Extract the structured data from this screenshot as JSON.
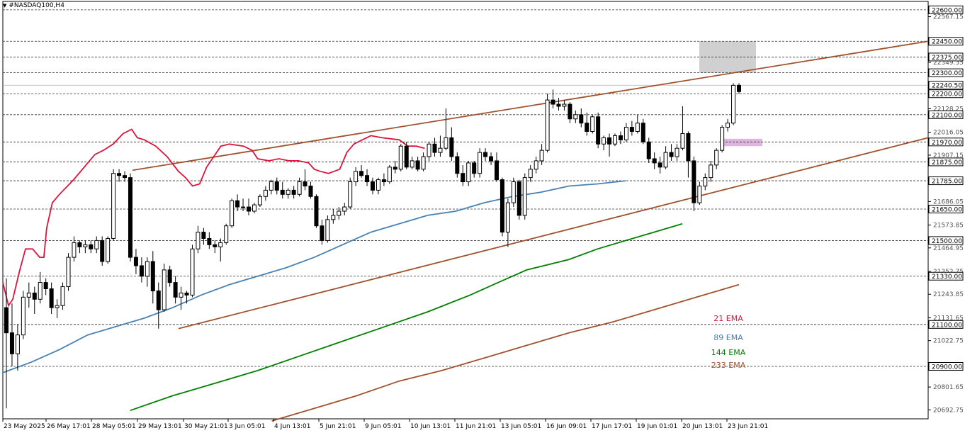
{
  "window": {
    "symbol_label": "#NASDAQ100,H4"
  },
  "chart_data": {
    "type": "candlestick",
    "instrument": "#NASDAQ100",
    "timeframe": "H4",
    "ylim": [
      20650,
      22640
    ],
    "y_ticks": [
      22567.15,
      22349.35,
      22128.25,
      22016.05,
      21907.15,
      21686.05,
      21573.85,
      21464.95,
      21352.75,
      21243.85,
      21131.65,
      21022.75,
      20801.65,
      20692.75
    ],
    "x_ticks": [
      "23 May 2025",
      "26 May 17:01",
      "28 May 05:01",
      "29 May 13:01",
      "30 May 21:01",
      "3 Jun 05:01",
      "4 Jun 13:01",
      "5 Jun 21:01",
      "9 Jun 05:01",
      "10 Jun 13:01",
      "11 Jun 21:01",
      "13 Jun 05:01",
      "16 Jun 09:01",
      "17 Jun 17:01",
      "19 Jun 01:01",
      "20 Jun 13:01",
      "23 Jun 21:01"
    ],
    "level_lines": [
      22600.0,
      22450.0,
      22375.0,
      22300.0,
      22200.0,
      22100.0,
      21970.0,
      21875.0,
      21785.0,
      21650.0,
      21500.0,
      21330.0,
      21100.0,
      20900.0
    ],
    "current_price": 22240.5,
    "candles": [
      [
        21180,
        21320,
        20700,
        21060
      ],
      [
        21060,
        21200,
        20900,
        20960
      ],
      [
        20960,
        21100,
        20880,
        21050
      ],
      [
        21050,
        21260,
        21030,
        21230
      ],
      [
        21230,
        21300,
        21180,
        21250
      ],
      [
        21250,
        21280,
        21150,
        21220
      ],
      [
        21220,
        21350,
        21200,
        21300
      ],
      [
        21300,
        21320,
        21240,
        21270
      ],
      [
        21270,
        21300,
        21150,
        21180
      ],
      [
        21180,
        21220,
        21130,
        21190
      ],
      [
        21190,
        21300,
        21170,
        21280
      ],
      [
        21280,
        21440,
        21260,
        21420
      ],
      [
        21420,
        21520,
        21400,
        21490
      ],
      [
        21490,
        21500,
        21440,
        21470
      ],
      [
        21470,
        21500,
        21440,
        21480
      ],
      [
        21480,
        21500,
        21440,
        21460
      ],
      [
        21460,
        21520,
        21440,
        21500
      ],
      [
        21500,
        21520,
        21380,
        21400
      ],
      [
        21400,
        21520,
        21390,
        21510
      ],
      [
        21510,
        21840,
        21500,
        21820
      ],
      [
        21820,
        21840,
        21780,
        21810
      ],
      [
        21810,
        21830,
        21780,
        21800
      ],
      [
        21800,
        21820,
        21400,
        21420
      ],
      [
        21420,
        21460,
        21340,
        21380
      ],
      [
        21380,
        21420,
        21300,
        21330
      ],
      [
        21330,
        21420,
        21280,
        21400
      ],
      [
        21400,
        21450,
        21200,
        21260
      ],
      [
        21260,
        21300,
        21080,
        21170
      ],
      [
        21170,
        21390,
        21160,
        21360
      ],
      [
        21360,
        21380,
        21280,
        21300
      ],
      [
        21300,
        21330,
        21200,
        21230
      ],
      [
        21230,
        21280,
        21170,
        21250
      ],
      [
        21250,
        21260,
        21200,
        21240
      ],
      [
        21240,
        21480,
        21230,
        21460
      ],
      [
        21460,
        21570,
        21440,
        21540
      ],
      [
        21540,
        21560,
        21480,
        21510
      ],
      [
        21510,
        21540,
        21460,
        21480
      ],
      [
        21480,
        21500,
        21440,
        21470
      ],
      [
        21470,
        21510,
        21400,
        21490
      ],
      [
        21490,
        21580,
        21480,
        21570
      ],
      [
        21570,
        21700,
        21560,
        21690
      ],
      [
        21690,
        21720,
        21640,
        21660
      ],
      [
        21660,
        21700,
        21640,
        21660
      ],
      [
        21660,
        21700,
        21620,
        21640
      ],
      [
        21640,
        21680,
        21630,
        21670
      ],
      [
        21670,
        21720,
        21660,
        21710
      ],
      [
        21710,
        21760,
        21690,
        21740
      ],
      [
        21740,
        21790,
        21720,
        21780
      ],
      [
        21780,
        21800,
        21720,
        21740
      ],
      [
        21740,
        21780,
        21700,
        21720
      ],
      [
        21720,
        21750,
        21700,
        21740
      ],
      [
        21740,
        21760,
        21700,
        21720
      ],
      [
        21720,
        21800,
        21710,
        21780
      ],
      [
        21780,
        21840,
        21740,
        21760
      ],
      [
        21760,
        21780,
        21700,
        21710
      ],
      [
        21710,
        21720,
        21560,
        21570
      ],
      [
        21570,
        21600,
        21480,
        21500
      ],
      [
        21500,
        21620,
        21490,
        21600
      ],
      [
        21600,
        21650,
        21580,
        21620
      ],
      [
        21620,
        21660,
        21600,
        21640
      ],
      [
        21640,
        21680,
        21620,
        21660
      ],
      [
        21660,
        21800,
        21650,
        21780
      ],
      [
        21780,
        21850,
        21760,
        21830
      ],
      [
        21830,
        21860,
        21800,
        21810
      ],
      [
        21810,
        21840,
        21760,
        21780
      ],
      [
        21780,
        21800,
        21720,
        21740
      ],
      [
        21740,
        21800,
        21720,
        21790
      ],
      [
        21790,
        21820,
        21760,
        21780
      ],
      [
        21780,
        21860,
        21770,
        21850
      ],
      [
        21850,
        21880,
        21820,
        21840
      ],
      [
        21840,
        21960,
        21830,
        21950
      ],
      [
        21950,
        21970,
        21840,
        21850
      ],
      [
        21850,
        21900,
        21840,
        21880
      ],
      [
        21880,
        21900,
        21830,
        21840
      ],
      [
        21840,
        21920,
        21830,
        21900
      ],
      [
        21900,
        21970,
        21880,
        21960
      ],
      [
        21960,
        21990,
        21900,
        21920
      ],
      [
        21920,
        22000,
        21900,
        21940
      ],
      [
        21940,
        22130,
        21930,
        21990
      ],
      [
        21990,
        22040,
        21880,
        21900
      ],
      [
        21900,
        21920,
        21800,
        21820
      ],
      [
        21820,
        21860,
        21760,
        21780
      ],
      [
        21780,
        21880,
        21760,
        21870
      ],
      [
        21870,
        21880,
        21800,
        21820
      ],
      [
        21820,
        21940,
        21800,
        21920
      ],
      [
        21920,
        21940,
        21880,
        21900
      ],
      [
        21900,
        21920,
        21860,
        21880
      ],
      [
        21880,
        21920,
        21780,
        21790
      ],
      [
        21790,
        21800,
        21520,
        21540
      ],
      [
        21540,
        21700,
        21470,
        21680
      ],
      [
        21680,
        21800,
        21660,
        21780
      ],
      [
        21780,
        21790,
        21600,
        21620
      ],
      [
        21620,
        21820,
        21600,
        21800
      ],
      [
        21800,
        21860,
        21780,
        21840
      ],
      [
        21840,
        21900,
        21820,
        21880
      ],
      [
        21880,
        21960,
        21860,
        21930
      ],
      [
        21930,
        22200,
        21920,
        22170
      ],
      [
        22170,
        22220,
        22130,
        22150
      ],
      [
        22150,
        22180,
        22120,
        22140
      ],
      [
        22140,
        22170,
        22120,
        22150
      ],
      [
        22150,
        22160,
        22060,
        22080
      ],
      [
        22080,
        22120,
        22060,
        22100
      ],
      [
        22100,
        22130,
        22040,
        22060
      ],
      [
        22060,
        22110,
        22000,
        22020
      ],
      [
        22020,
        22100,
        22010,
        22090
      ],
      [
        22090,
        22110,
        21940,
        21960
      ],
      [
        21960,
        22000,
        21930,
        21990
      ],
      [
        21990,
        22010,
        21900,
        21960
      ],
      [
        21960,
        22010,
        21950,
        22000
      ],
      [
        22000,
        22020,
        21960,
        21980
      ],
      [
        21980,
        22060,
        21970,
        22040
      ],
      [
        22040,
        22070,
        22000,
        22020
      ],
      [
        22020,
        22100,
        22010,
        22060
      ],
      [
        22060,
        22080,
        21960,
        21970
      ],
      [
        21970,
        21990,
        21870,
        21890
      ],
      [
        21890,
        21920,
        21840,
        21870
      ],
      [
        21870,
        21900,
        21820,
        21850
      ],
      [
        21850,
        21950,
        21840,
        21920
      ],
      [
        21920,
        21960,
        21880,
        21900
      ],
      [
        21900,
        21960,
        21880,
        21940
      ],
      [
        21940,
        22140,
        21930,
        22010
      ],
      [
        22010,
        22020,
        21800,
        21880
      ],
      [
        21880,
        21900,
        21640,
        21680
      ],
      [
        21680,
        21780,
        21670,
        21760
      ],
      [
        21760,
        21820,
        21740,
        21800
      ],
      [
        21800,
        21880,
        21780,
        21860
      ],
      [
        21860,
        21940,
        21840,
        21930
      ],
      [
        21930,
        22050,
        21920,
        22040
      ],
      [
        22040,
        22080,
        22020,
        22060
      ],
      [
        22060,
        22250,
        22050,
        22240
      ],
      [
        22240,
        22250,
        22200,
        22210
      ]
    ],
    "series": [
      {
        "name": "21 EMA",
        "color": "#dc143c",
        "values": [
          [
            0,
            21300
          ],
          [
            8,
            21190
          ],
          [
            14,
            21220
          ],
          [
            24,
            21360
          ],
          [
            32,
            21460
          ],
          [
            42,
            21460
          ],
          [
            52,
            21420
          ],
          [
            58,
            21420
          ],
          [
            62,
            21560
          ],
          [
            70,
            21680
          ],
          [
            80,
            21720
          ],
          [
            100,
            21790
          ],
          [
            120,
            21870
          ],
          [
            130,
            21910
          ],
          [
            142,
            21930
          ],
          [
            156,
            21960
          ],
          [
            170,
            22010
          ],
          [
            182,
            22030
          ],
          [
            190,
            21990
          ],
          [
            200,
            21980
          ],
          [
            216,
            21950
          ],
          [
            232,
            21900
          ],
          [
            248,
            21830
          ],
          [
            258,
            21800
          ],
          [
            268,
            21760
          ],
          [
            278,
            21770
          ],
          [
            288,
            21850
          ],
          [
            298,
            21900
          ],
          [
            308,
            21950
          ],
          [
            320,
            21960
          ],
          [
            340,
            21950
          ],
          [
            352,
            21930
          ],
          [
            360,
            21890
          ],
          [
            376,
            21880
          ],
          [
            390,
            21890
          ],
          [
            404,
            21880
          ],
          [
            418,
            21880
          ],
          [
            432,
            21870
          ],
          [
            440,
            21840
          ],
          [
            448,
            21830
          ],
          [
            460,
            21820
          ],
          [
            476,
            21840
          ],
          [
            486,
            21920
          ],
          [
            496,
            21960
          ],
          [
            508,
            21980
          ],
          [
            520,
            22000
          ],
          [
            536,
            21990
          ],
          [
            560,
            21980
          ],
          [
            572,
            21950
          ],
          [
            584,
            21950
          ],
          [
            596,
            21940
          ]
        ]
      },
      {
        "name": "89 EMA",
        "color": "#4682b4",
        "values": [
          [
            0,
            20870
          ],
          [
            40,
            20920
          ],
          [
            80,
            20980
          ],
          [
            120,
            21050
          ],
          [
            160,
            21090
          ],
          [
            200,
            21130
          ],
          [
            240,
            21180
          ],
          [
            280,
            21240
          ],
          [
            320,
            21290
          ],
          [
            360,
            21330
          ],
          [
            400,
            21370
          ],
          [
            440,
            21420
          ],
          [
            480,
            21480
          ],
          [
            520,
            21540
          ],
          [
            560,
            21580
          ],
          [
            600,
            21620
          ],
          [
            640,
            21640
          ],
          [
            680,
            21680
          ],
          [
            720,
            21710
          ],
          [
            760,
            21730
          ],
          [
            800,
            21760
          ],
          [
            840,
            21770
          ],
          [
            880,
            21785
          ]
        ]
      },
      {
        "name": "144 EMA",
        "color": "#008000",
        "values": [
          [
            180,
            20690
          ],
          [
            240,
            20760
          ],
          [
            300,
            20820
          ],
          [
            360,
            20880
          ],
          [
            420,
            20950
          ],
          [
            480,
            21020
          ],
          [
            540,
            21090
          ],
          [
            600,
            21160
          ],
          [
            660,
            21240
          ],
          [
            700,
            21300
          ],
          [
            740,
            21360
          ],
          [
            800,
            21410
          ],
          [
            840,
            21460
          ],
          [
            880,
            21500
          ],
          [
            920,
            21540
          ],
          [
            960,
            21580
          ]
        ]
      },
      {
        "name": "233 EMA",
        "color": "#a0522d",
        "values": [
          [
            380,
            20640
          ],
          [
            440,
            20700
          ],
          [
            500,
            20760
          ],
          [
            560,
            20830
          ],
          [
            620,
            20880
          ],
          [
            680,
            20940
          ],
          [
            740,
            21000
          ],
          [
            800,
            21060
          ],
          [
            860,
            21110
          ],
          [
            920,
            21170
          ],
          [
            980,
            21230
          ],
          [
            1040,
            21290
          ]
        ]
      }
    ],
    "trendlines": [
      {
        "color": "#a0522d",
        "points": [
          [
            21835,
            0
          ],
          [
            22450,
            1
          ]
        ]
      },
      {
        "color": "#a0522d",
        "points": [
          [
            21080,
            0
          ],
          [
            21990,
            1
          ]
        ]
      }
    ],
    "zones": [
      {
        "color": "#c8c8c8",
        "y": [
          22300,
          22450
        ]
      },
      {
        "color": "#d8a8d8",
        "y": [
          21950,
          21985
        ]
      }
    ],
    "legend": [
      {
        "label": "21 EMA",
        "color": "#dc143c"
      },
      {
        "label": "89 EMA",
        "color": "#4682b4"
      },
      {
        "label": "144 EMA",
        "color": "#008000"
      },
      {
        "label": "233 EMA",
        "color": "#a0522d"
      }
    ],
    "grid": false,
    "legend_position": "bottom-right"
  }
}
